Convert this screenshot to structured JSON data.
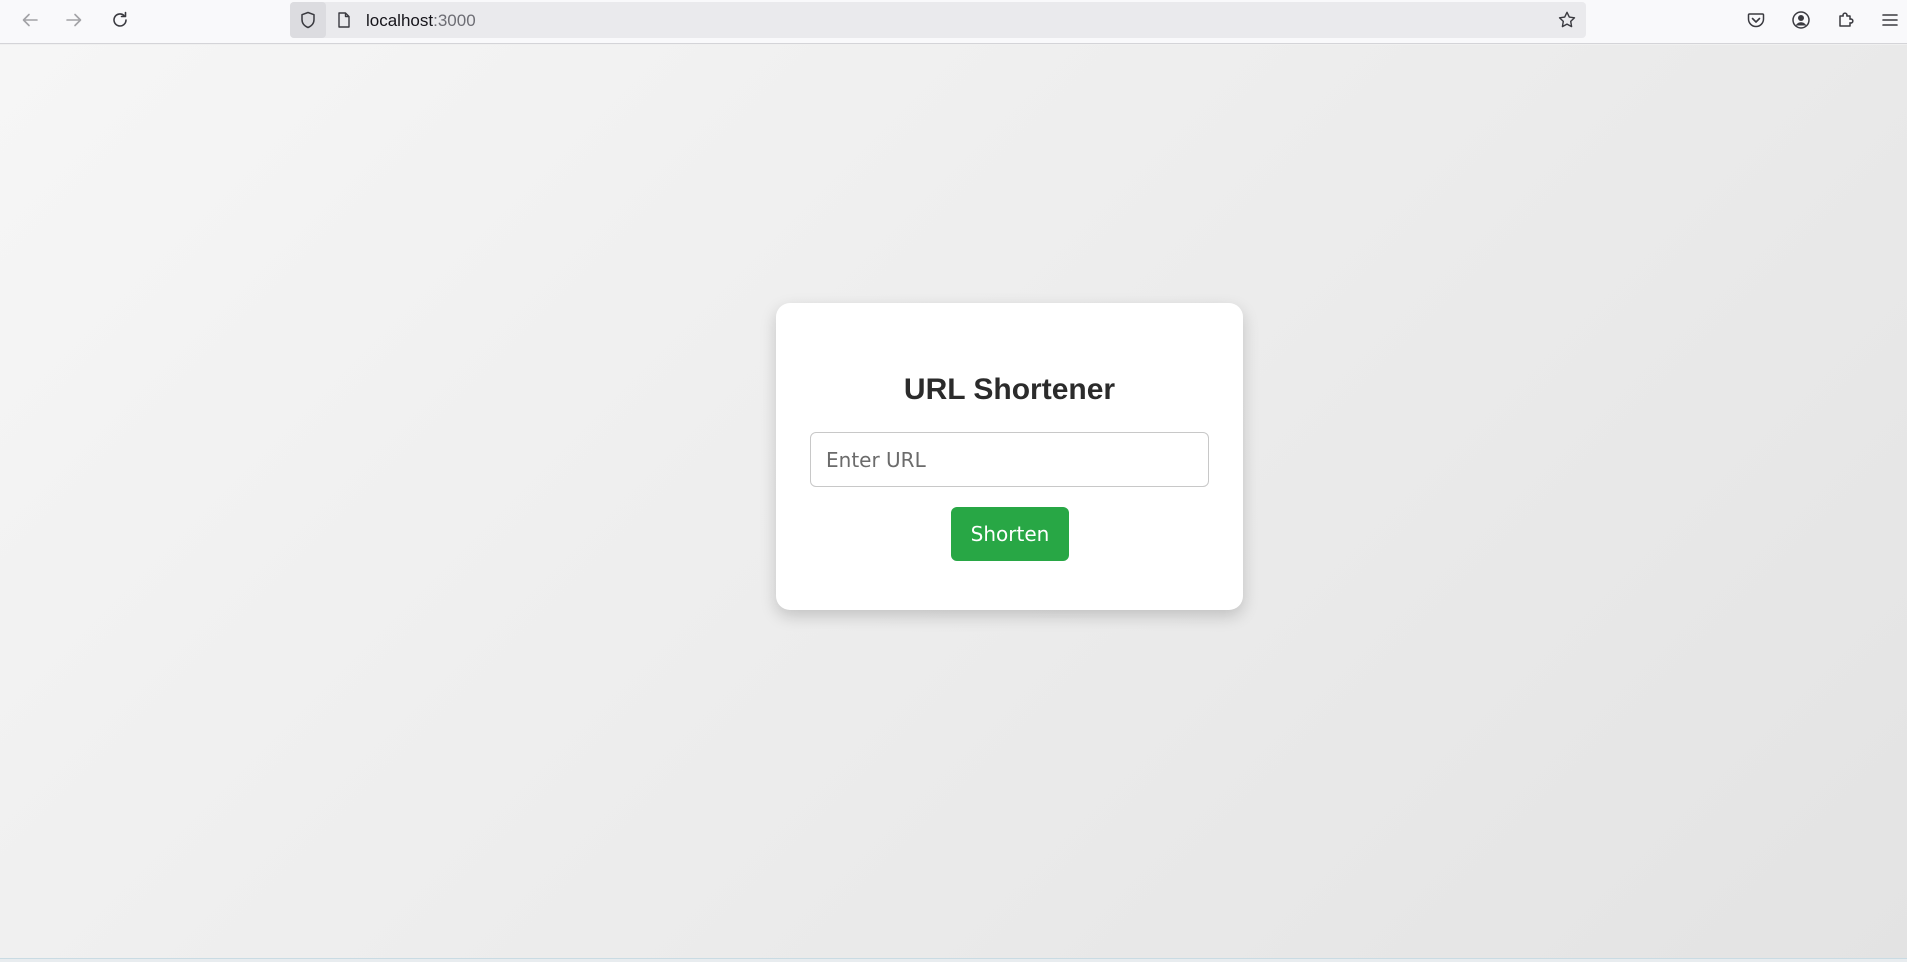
{
  "browser": {
    "url_host": "localhost",
    "url_port": ":3000",
    "icons": {
      "back": "arrow-left-icon",
      "forward": "arrow-right-icon",
      "reload": "reload-icon",
      "shield": "shield-icon",
      "page": "page-icon",
      "bookmark": "star-icon",
      "pocket": "pocket-icon",
      "account": "account-icon",
      "extensions": "puzzle-icon",
      "menu": "hamburger-menu-icon"
    }
  },
  "card": {
    "title": "URL Shortener",
    "input_placeholder": "Enter URL",
    "input_value": "",
    "button_label": "Shorten"
  },
  "colors": {
    "accent": "#28a745",
    "card_background": "#ffffff",
    "page_background": "#ebebeb",
    "title_text": "#2b2b2b"
  }
}
